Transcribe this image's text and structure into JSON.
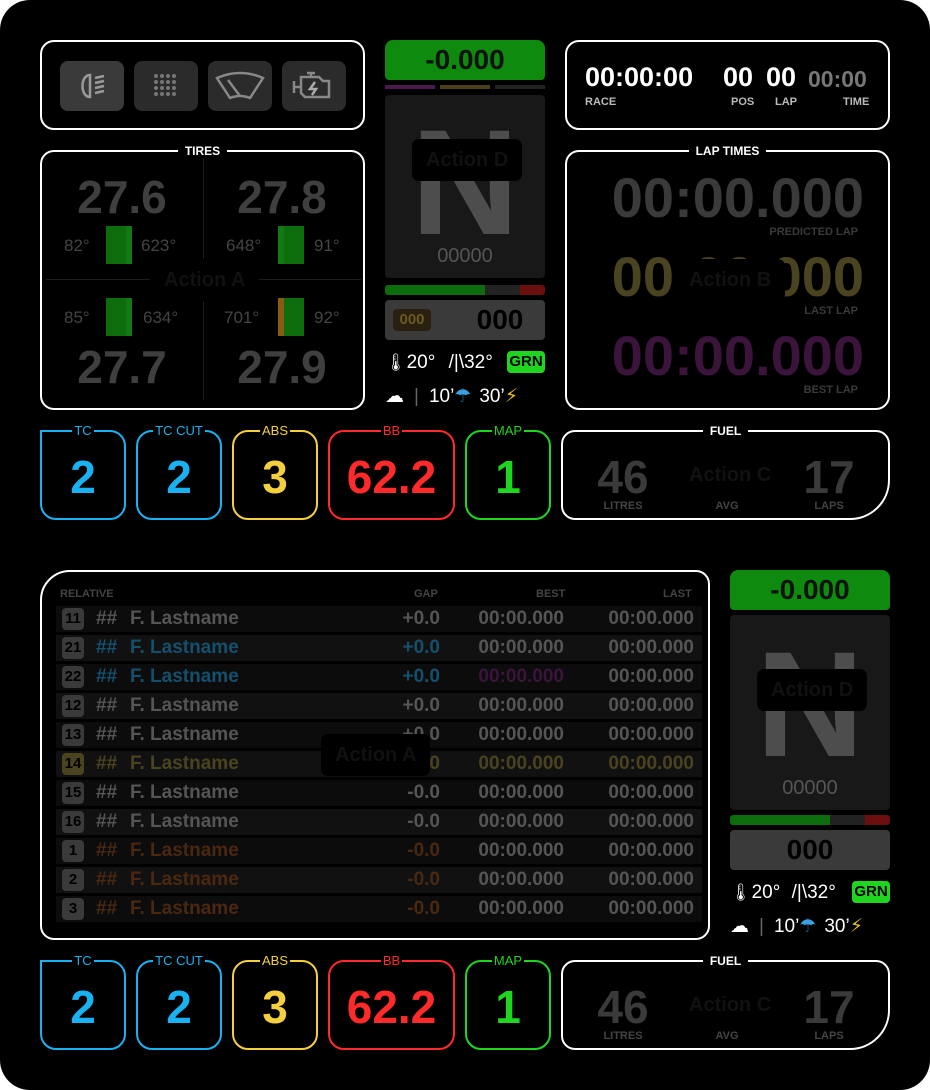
{
  "colors": {
    "tc": "#1ab1f0",
    "abs": "#f4d03f",
    "bb": "#ff2a2a",
    "map": "#1fd51f",
    "delta_bg": "#0f8a0f",
    "grn": "#1fd51f"
  },
  "status_icons": [
    "headlight-icon",
    "grid-icon",
    "wiper-icon",
    "engine-icon"
  ],
  "tires": {
    "title": "TIRES",
    "fl": {
      "pressure": "27.6",
      "temp": "82°",
      "wear": "623°"
    },
    "fr": {
      "pressure": "27.8",
      "temp": "648°",
      "wear": "91°"
    },
    "rl": {
      "pressure": "27.7",
      "temp": "85°",
      "wear": "634°"
    },
    "rr": {
      "pressure": "27.9",
      "temp": "701°",
      "wear": "92°"
    }
  },
  "gear_panel": {
    "delta": "-0.000",
    "gear": "N",
    "rpm": "00000",
    "speed": "000",
    "limiter": "000"
  },
  "weather": {
    "air": "20°",
    "track": "32°",
    "flag": "GRN",
    "rain_now_icon": "cloud-icon",
    "rain_10": "10’",
    "rain_30": "30’"
  },
  "timing": {
    "race": "00:00:00",
    "race_label": "RACE",
    "pos": "00",
    "pos_label": "POS",
    "lap": "00",
    "lap_label": "LAP",
    "time": "00:00",
    "time_label": "TIME"
  },
  "lap_times": {
    "title": "LAP TIMES",
    "predicted": "00:00.000",
    "predicted_label": "PREDICTED LAP",
    "last": "00:00.000",
    "last_label": "LAST LAP",
    "best": "00:00.000",
    "best_label": "BEST LAP"
  },
  "settings": {
    "tc_label": "TC",
    "tc": "2",
    "tccut_label": "TC CUT",
    "tccut": "2",
    "abs_label": "ABS",
    "abs": "3",
    "bb_label": "BB",
    "bb": "62.2",
    "map_label": "MAP",
    "map": "1"
  },
  "fuel": {
    "title": "FUEL",
    "litres": "46",
    "litres_label": "LITRES",
    "avg_label": "AVG",
    "laps": "17",
    "laps_label": "LAPS"
  },
  "relative": {
    "header": {
      "relative": "RELATIVE",
      "gap": "GAP",
      "best": "BEST",
      "last": "LAST"
    },
    "rows": [
      {
        "pos": "11",
        "num": "##",
        "name": "F. Lastname",
        "gap": "+0.0",
        "best": "00:00.000",
        "last": "00:00.000"
      },
      {
        "pos": "21",
        "num": "##",
        "name": "F. Lastname",
        "gap": "+0.0",
        "best": "00:00.000",
        "last": "00:00.000"
      },
      {
        "pos": "22",
        "num": "##",
        "name": "F. Lastname",
        "gap": "+0.0",
        "best": "00:00.000",
        "last": "00:00.000"
      },
      {
        "pos": "12",
        "num": "##",
        "name": "F. Lastname",
        "gap": "+0.0",
        "best": "00:00.000",
        "last": "00:00.000"
      },
      {
        "pos": "13",
        "num": "##",
        "name": "F. Lastname",
        "gap": "+0.0",
        "best": "00:00.000",
        "last": "00:00.000"
      },
      {
        "pos": "14",
        "num": "##",
        "name": "F. Lastname",
        "gap": "+0.0",
        "best": "00:00.000",
        "last": "00:00.000"
      },
      {
        "pos": "15",
        "num": "##",
        "name": "F. Lastname",
        "gap": "-0.0",
        "best": "00:00.000",
        "last": "00:00.000"
      },
      {
        "pos": "16",
        "num": "##",
        "name": "F. Lastname",
        "gap": "-0.0",
        "best": "00:00.000",
        "last": "00:00.000"
      },
      {
        "pos": "1",
        "num": "##",
        "name": "F. Lastname",
        "gap": "-0.0",
        "best": "00:00.000",
        "last": "00:00.000"
      },
      {
        "pos": "2",
        "num": "##",
        "name": "F. Lastname",
        "gap": "-0.0",
        "best": "00:00.000",
        "last": "00:00.000"
      },
      {
        "pos": "3",
        "num": "##",
        "name": "F. Lastname",
        "gap": "-0.0",
        "best": "00:00.000",
        "last": "00:00.000"
      }
    ]
  },
  "hotspots": {
    "action_a": "Action A",
    "action_b": "Action B",
    "action_c": "Action C",
    "action_d": "Action D"
  }
}
